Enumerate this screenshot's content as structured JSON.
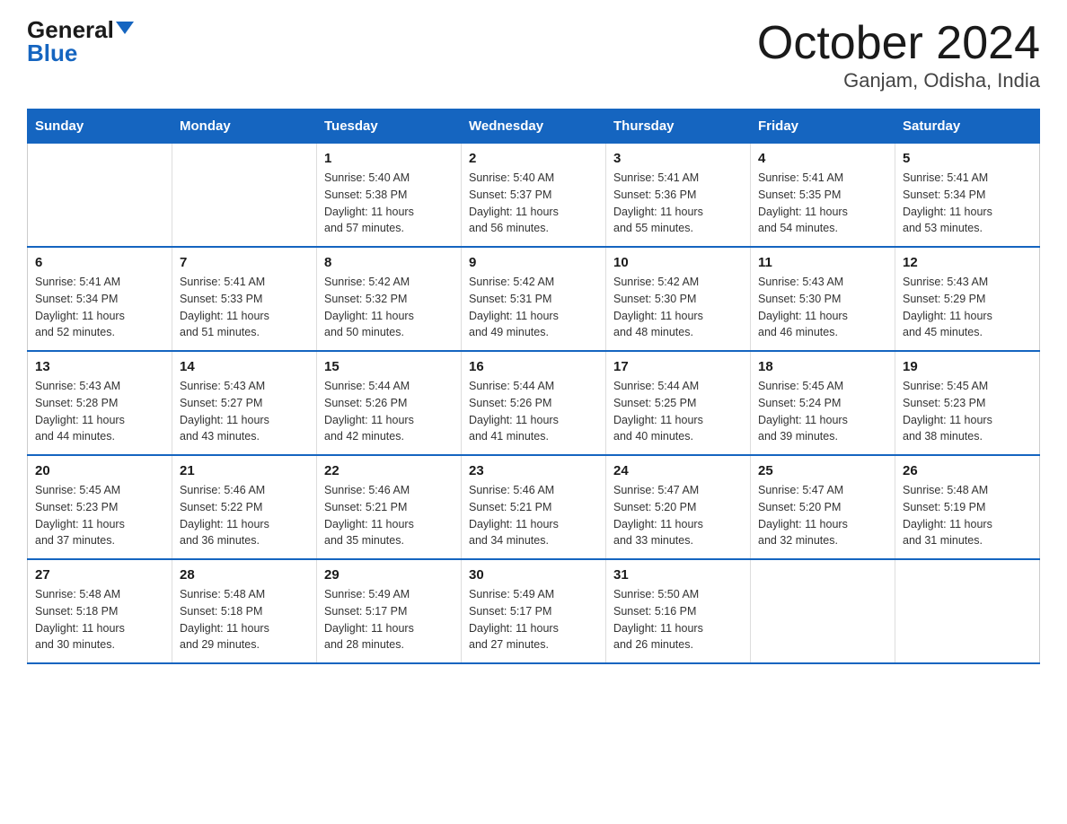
{
  "logo": {
    "general": "General",
    "triangle": "▶",
    "blue": "Blue"
  },
  "title": "October 2024",
  "subtitle": "Ganjam, Odisha, India",
  "weekdays": [
    "Sunday",
    "Monday",
    "Tuesday",
    "Wednesday",
    "Thursday",
    "Friday",
    "Saturday"
  ],
  "weeks": [
    [
      {
        "day": "",
        "info": ""
      },
      {
        "day": "",
        "info": ""
      },
      {
        "day": "1",
        "info": "Sunrise: 5:40 AM\nSunset: 5:38 PM\nDaylight: 11 hours\nand 57 minutes."
      },
      {
        "day": "2",
        "info": "Sunrise: 5:40 AM\nSunset: 5:37 PM\nDaylight: 11 hours\nand 56 minutes."
      },
      {
        "day": "3",
        "info": "Sunrise: 5:41 AM\nSunset: 5:36 PM\nDaylight: 11 hours\nand 55 minutes."
      },
      {
        "day": "4",
        "info": "Sunrise: 5:41 AM\nSunset: 5:35 PM\nDaylight: 11 hours\nand 54 minutes."
      },
      {
        "day": "5",
        "info": "Sunrise: 5:41 AM\nSunset: 5:34 PM\nDaylight: 11 hours\nand 53 minutes."
      }
    ],
    [
      {
        "day": "6",
        "info": "Sunrise: 5:41 AM\nSunset: 5:34 PM\nDaylight: 11 hours\nand 52 minutes."
      },
      {
        "day": "7",
        "info": "Sunrise: 5:41 AM\nSunset: 5:33 PM\nDaylight: 11 hours\nand 51 minutes."
      },
      {
        "day": "8",
        "info": "Sunrise: 5:42 AM\nSunset: 5:32 PM\nDaylight: 11 hours\nand 50 minutes."
      },
      {
        "day": "9",
        "info": "Sunrise: 5:42 AM\nSunset: 5:31 PM\nDaylight: 11 hours\nand 49 minutes."
      },
      {
        "day": "10",
        "info": "Sunrise: 5:42 AM\nSunset: 5:30 PM\nDaylight: 11 hours\nand 48 minutes."
      },
      {
        "day": "11",
        "info": "Sunrise: 5:43 AM\nSunset: 5:30 PM\nDaylight: 11 hours\nand 46 minutes."
      },
      {
        "day": "12",
        "info": "Sunrise: 5:43 AM\nSunset: 5:29 PM\nDaylight: 11 hours\nand 45 minutes."
      }
    ],
    [
      {
        "day": "13",
        "info": "Sunrise: 5:43 AM\nSunset: 5:28 PM\nDaylight: 11 hours\nand 44 minutes."
      },
      {
        "day": "14",
        "info": "Sunrise: 5:43 AM\nSunset: 5:27 PM\nDaylight: 11 hours\nand 43 minutes."
      },
      {
        "day": "15",
        "info": "Sunrise: 5:44 AM\nSunset: 5:26 PM\nDaylight: 11 hours\nand 42 minutes."
      },
      {
        "day": "16",
        "info": "Sunrise: 5:44 AM\nSunset: 5:26 PM\nDaylight: 11 hours\nand 41 minutes."
      },
      {
        "day": "17",
        "info": "Sunrise: 5:44 AM\nSunset: 5:25 PM\nDaylight: 11 hours\nand 40 minutes."
      },
      {
        "day": "18",
        "info": "Sunrise: 5:45 AM\nSunset: 5:24 PM\nDaylight: 11 hours\nand 39 minutes."
      },
      {
        "day": "19",
        "info": "Sunrise: 5:45 AM\nSunset: 5:23 PM\nDaylight: 11 hours\nand 38 minutes."
      }
    ],
    [
      {
        "day": "20",
        "info": "Sunrise: 5:45 AM\nSunset: 5:23 PM\nDaylight: 11 hours\nand 37 minutes."
      },
      {
        "day": "21",
        "info": "Sunrise: 5:46 AM\nSunset: 5:22 PM\nDaylight: 11 hours\nand 36 minutes."
      },
      {
        "day": "22",
        "info": "Sunrise: 5:46 AM\nSunset: 5:21 PM\nDaylight: 11 hours\nand 35 minutes."
      },
      {
        "day": "23",
        "info": "Sunrise: 5:46 AM\nSunset: 5:21 PM\nDaylight: 11 hours\nand 34 minutes."
      },
      {
        "day": "24",
        "info": "Sunrise: 5:47 AM\nSunset: 5:20 PM\nDaylight: 11 hours\nand 33 minutes."
      },
      {
        "day": "25",
        "info": "Sunrise: 5:47 AM\nSunset: 5:20 PM\nDaylight: 11 hours\nand 32 minutes."
      },
      {
        "day": "26",
        "info": "Sunrise: 5:48 AM\nSunset: 5:19 PM\nDaylight: 11 hours\nand 31 minutes."
      }
    ],
    [
      {
        "day": "27",
        "info": "Sunrise: 5:48 AM\nSunset: 5:18 PM\nDaylight: 11 hours\nand 30 minutes."
      },
      {
        "day": "28",
        "info": "Sunrise: 5:48 AM\nSunset: 5:18 PM\nDaylight: 11 hours\nand 29 minutes."
      },
      {
        "day": "29",
        "info": "Sunrise: 5:49 AM\nSunset: 5:17 PM\nDaylight: 11 hours\nand 28 minutes."
      },
      {
        "day": "30",
        "info": "Sunrise: 5:49 AM\nSunset: 5:17 PM\nDaylight: 11 hours\nand 27 minutes."
      },
      {
        "day": "31",
        "info": "Sunrise: 5:50 AM\nSunset: 5:16 PM\nDaylight: 11 hours\nand 26 minutes."
      },
      {
        "day": "",
        "info": ""
      },
      {
        "day": "",
        "info": ""
      }
    ]
  ]
}
